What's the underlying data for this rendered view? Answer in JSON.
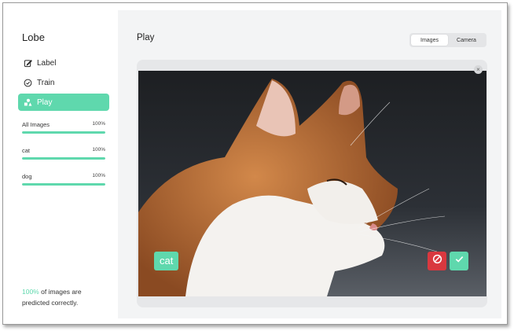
{
  "app": {
    "title": "Lobe"
  },
  "sidebar": {
    "items": [
      {
        "label": "Label",
        "icon": "pencil-icon",
        "active": false
      },
      {
        "label": "Train",
        "icon": "check-circle-icon",
        "active": false
      },
      {
        "label": "Play",
        "icon": "shapes-icon",
        "active": true
      }
    ],
    "labels": [
      {
        "name": "All Images",
        "percent": "100%",
        "value": 1.0
      },
      {
        "name": "cat",
        "percent": "100%",
        "value": 1.0
      },
      {
        "name": "dog",
        "percent": "100%",
        "value": 1.0
      }
    ],
    "footer": {
      "accuracy": "100%",
      "text": " of images are predicted correctly."
    }
  },
  "main": {
    "title": "Play",
    "tabs": [
      {
        "label": "Images",
        "active": true
      },
      {
        "label": "Camera",
        "active": false
      }
    ],
    "close_symbol": "×",
    "prediction": {
      "label": "cat"
    },
    "actions": [
      {
        "icon": "block-icon",
        "color": "#d9383f"
      },
      {
        "icon": "check-icon",
        "color": "#5fd8ad"
      }
    ]
  },
  "colors": {
    "accent": "#5fd8ad",
    "danger": "#d9383f",
    "background": "#f3f4f5"
  }
}
